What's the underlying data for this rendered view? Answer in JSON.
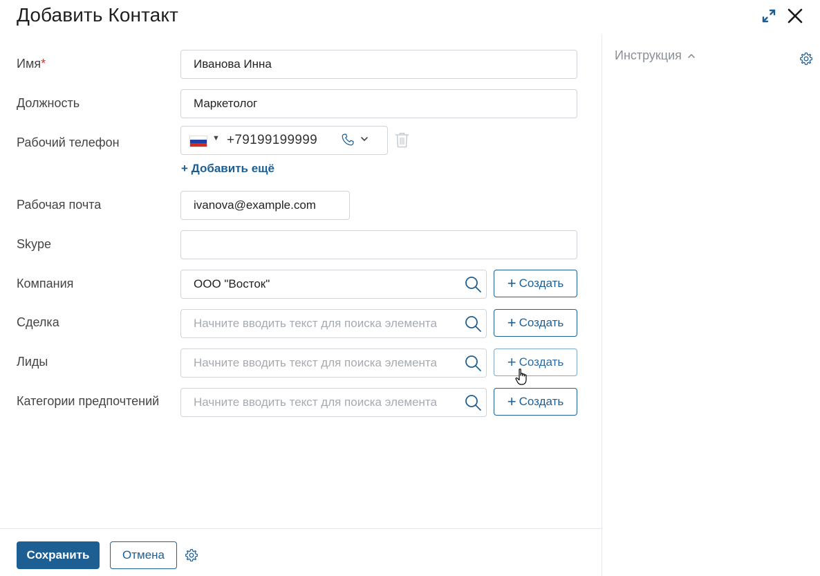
{
  "header": {
    "title": "Добавить Контакт",
    "expand_icon": "expand-icon",
    "close_icon": "close-icon"
  },
  "fields": {
    "name": {
      "label": "Имя",
      "required_mark": "*",
      "value": "Иванова Инна"
    },
    "position": {
      "label": "Должность",
      "value": "Маркетолог"
    },
    "work_phone": {
      "label": "Рабочий телефон",
      "country_flag": "flag-russia-icon",
      "value": "+79199199999",
      "add_more": "+ Добавить ещё"
    },
    "work_email": {
      "label": "Рабочая почта",
      "value": "ivanova@example.com"
    },
    "skype": {
      "label": "Skype",
      "value": ""
    },
    "company": {
      "label": "Компания",
      "value": "ООО \"Восток\"",
      "create_label": "Создать"
    },
    "deal": {
      "label": "Сделка",
      "placeholder": "Начните вводить текст для поиска элемента",
      "create_label": "Создать"
    },
    "leads": {
      "label": "Лиды",
      "placeholder": "Начните вводить текст для поиска элемента",
      "create_label": "Создать"
    },
    "preference_categories": {
      "label": "Категории предпочтений",
      "placeholder": "Начните вводить текст для поиска элемента",
      "create_label": "Создать"
    }
  },
  "sidebar": {
    "instruction_label": "Инструкция"
  },
  "footer": {
    "save_label": "Сохранить",
    "cancel_label": "Отмена"
  },
  "colors": {
    "accent": "#1e5f93",
    "required": "#d0342c",
    "border": "#cfd4da",
    "placeholder": "#a6abb1"
  }
}
